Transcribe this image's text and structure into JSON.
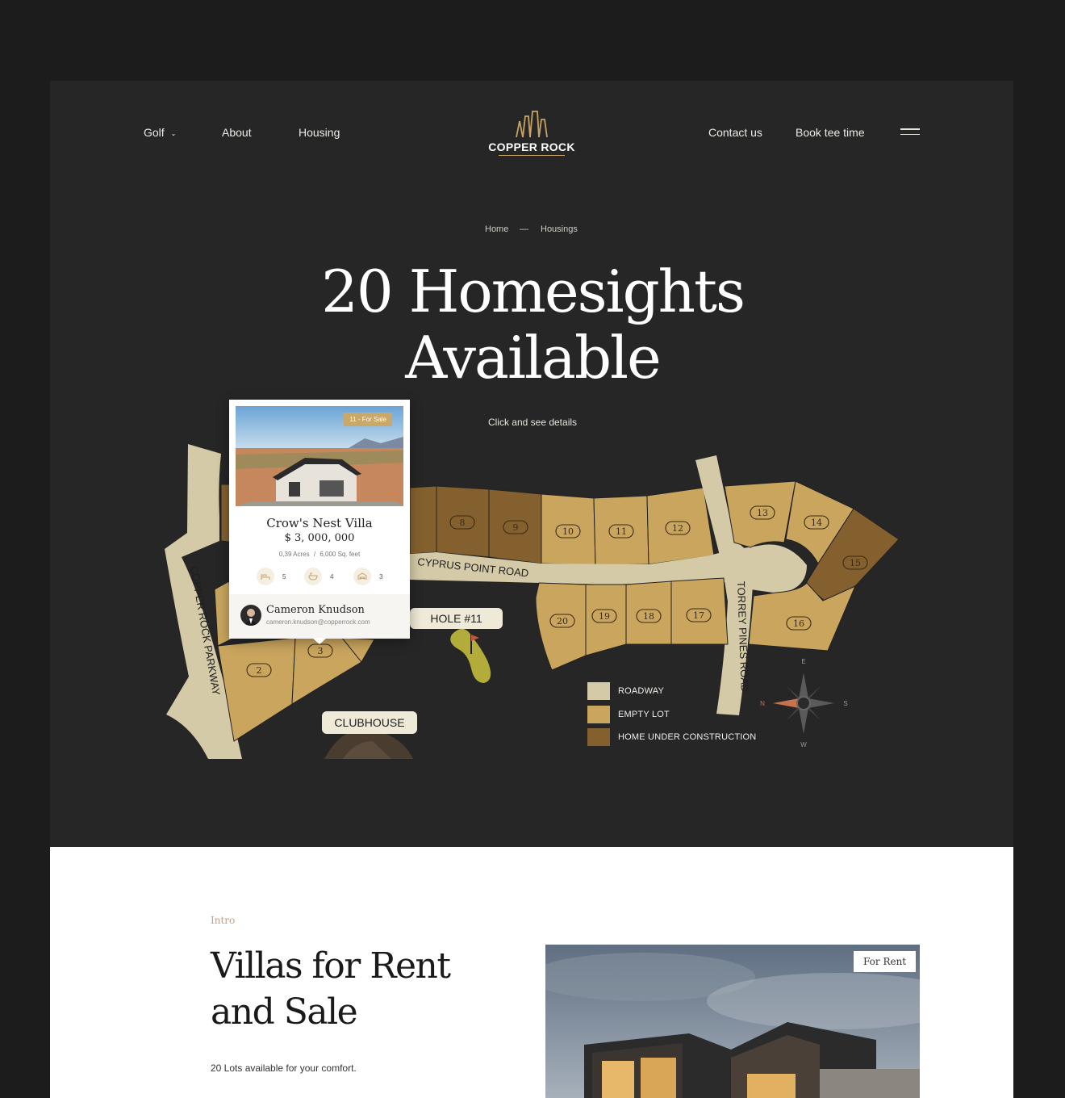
{
  "nav": {
    "golf": "Golf",
    "about": "About",
    "housing": "Housing",
    "contact": "Contact us",
    "book": "Book tee time",
    "logo_text": "COPPER ROCK"
  },
  "breadcrumb": {
    "home": "Home",
    "sep": "—",
    "current": "Housings"
  },
  "hero": {
    "title_line1": "20 Homesights",
    "title_line2": "Available",
    "subtitle": "Click and see details"
  },
  "map": {
    "roads": {
      "parkway": "COPPER ROCK PARKWAY",
      "cyprus": "CYPRUS POINT ROAD",
      "torrey": "TORREY PINES ROAD"
    },
    "lots": [
      "2",
      "3",
      "8",
      "9",
      "10",
      "11",
      "12",
      "13",
      "14",
      "15",
      "16",
      "17",
      "18",
      "19",
      "20"
    ],
    "hole_label": "HOLE #11",
    "clubhouse_label": "CLUBHOUSE",
    "legend": {
      "roadway": "ROADWAY",
      "empty": "EMPTY LOT",
      "construction": "HOME UNDER CONSTRUCTION"
    },
    "compass": {
      "e": "E",
      "s": "S",
      "w": "W",
      "n": "N"
    },
    "colors": {
      "road": "#d4caa7",
      "empty": "#c9a55d",
      "construction": "#84602f"
    }
  },
  "card": {
    "badge": "11 - For Sale",
    "name": "Crow's Nest Villa",
    "price": "$ 3, 000, 000",
    "acres": "0,39 Acres",
    "sep": "/",
    "sqft": "6,000 Sq. feet",
    "beds": "5",
    "baths": "4",
    "garage": "3",
    "agent_name": "Cameron Knudson",
    "agent_email": "cameron.knudson@copperrock.com"
  },
  "intro": {
    "label": "Intro",
    "title_line1": "Villas for Rent",
    "title_line2": "and Sale",
    "lots_text": "20 Lots available  for your comfort.",
    "badge": "For Rent"
  }
}
